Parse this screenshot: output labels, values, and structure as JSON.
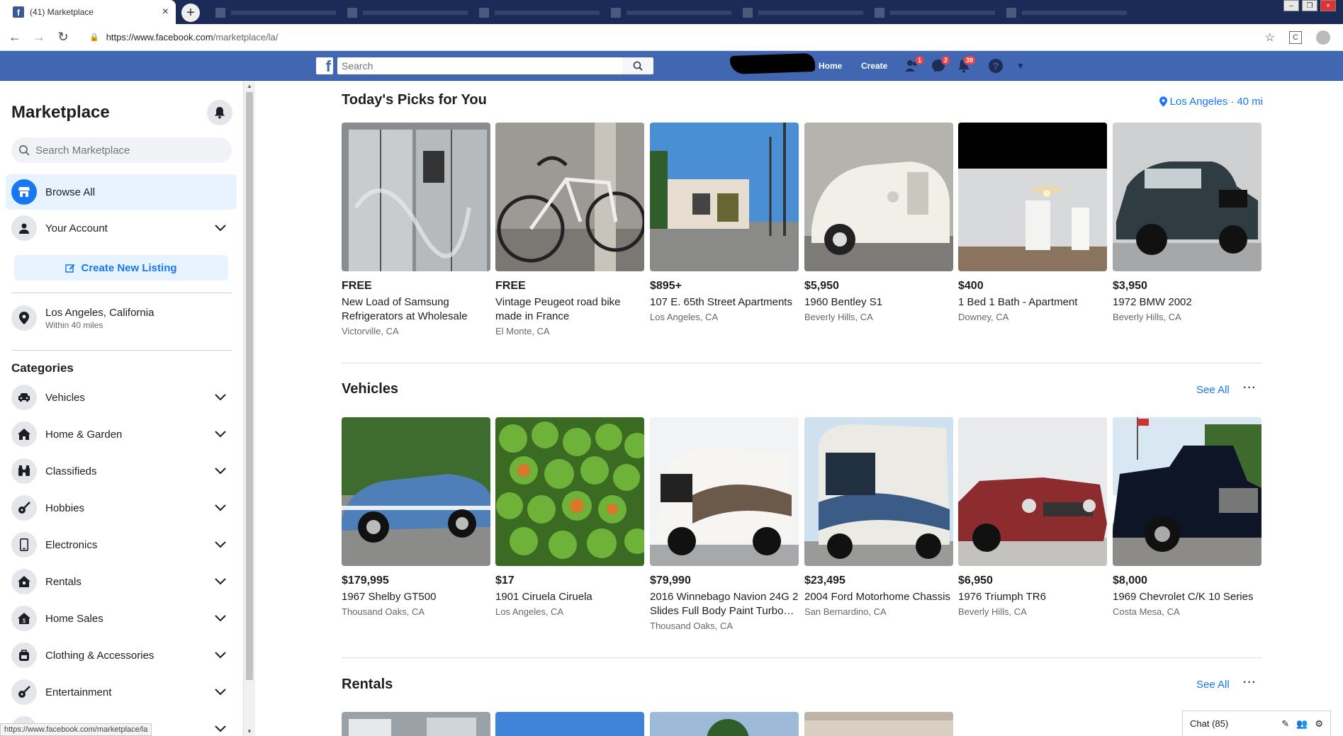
{
  "browser": {
    "active_tab_title": "(41) Marketplace",
    "url_host": "https://www.facebook.com",
    "url_path": "/marketplace/la/",
    "status_url": "https://www.facebook.com/marketplace/la"
  },
  "topbar": {
    "search_placeholder": "Search",
    "home_label": "Home",
    "create_label": "Create",
    "friends_badge": "1",
    "messages_badge": "2",
    "notifications_badge": "39"
  },
  "sidebar": {
    "title": "Marketplace",
    "search_placeholder": "Search Marketplace",
    "browse_all": "Browse All",
    "your_account": "Your Account",
    "create_listing": "Create New Listing",
    "location": "Los Angeles, California",
    "radius": "Within 40 miles",
    "categories_title": "Categories",
    "categories": [
      {
        "label": "Vehicles",
        "icon": "car-icon"
      },
      {
        "label": "Home & Garden",
        "icon": "house-icon"
      },
      {
        "label": "Classifieds",
        "icon": "binoculars-icon"
      },
      {
        "label": "Hobbies",
        "icon": "guitar-icon"
      },
      {
        "label": "Electronics",
        "icon": "phone-icon"
      },
      {
        "label": "Rentals",
        "icon": "rental-house-icon"
      },
      {
        "label": "Home Sales",
        "icon": "home-sale-icon"
      },
      {
        "label": "Clothing & Accessories",
        "icon": "backpack-icon"
      },
      {
        "label": "Entertainment",
        "icon": "guitar-icon"
      }
    ]
  },
  "main": {
    "picks": {
      "title": "Today's Picks for You",
      "location": "Los Angeles",
      "distance": "40 mi",
      "items": [
        {
          "price": "FREE",
          "name": "New Load of Samsung Refrigerators at Wholesale",
          "loc": "Victorville, CA"
        },
        {
          "price": "FREE",
          "name": "Vintage Peugeot road bike made in France",
          "loc": "El Monte, CA"
        },
        {
          "price": "$895+",
          "name": "107 E. 65th Street Apartments",
          "loc": "Los Angeles, CA"
        },
        {
          "price": "$5,950",
          "name": "1960 Bentley S1",
          "loc": "Beverly Hills, CA"
        },
        {
          "price": "$400",
          "name": "1 Bed 1 Bath - Apartment",
          "loc": "Downey, CA"
        },
        {
          "price": "$3,950",
          "name": "1972 BMW 2002",
          "loc": "Beverly Hills, CA"
        }
      ]
    },
    "vehicles": {
      "title": "Vehicles",
      "see_all": "See All",
      "items": [
        {
          "price": "$179,995",
          "name": "1967 Shelby GT500",
          "loc": "Thousand Oaks, CA"
        },
        {
          "price": "$17",
          "name": "1901 Ciruela Ciruela",
          "loc": "Los Angeles, CA"
        },
        {
          "price": "$79,990",
          "name": "2016 Winnebago Navion 24G 2 Slides Full Body Paint Turbo…",
          "loc": "Thousand Oaks, CA"
        },
        {
          "price": "$23,495",
          "name": "2004 Ford Motorhome Chassis",
          "loc": "San Bernardino, CA"
        },
        {
          "price": "$6,950",
          "name": "1976 Triumph TR6",
          "loc": "Beverly Hills, CA"
        },
        {
          "price": "$8,000",
          "name": "1969 Chevrolet C/K 10 Series",
          "loc": "Costa Mesa, CA"
        }
      ]
    },
    "rentals": {
      "title": "Rentals",
      "see_all": "See All"
    }
  },
  "chat": {
    "label": "Chat (85)"
  }
}
